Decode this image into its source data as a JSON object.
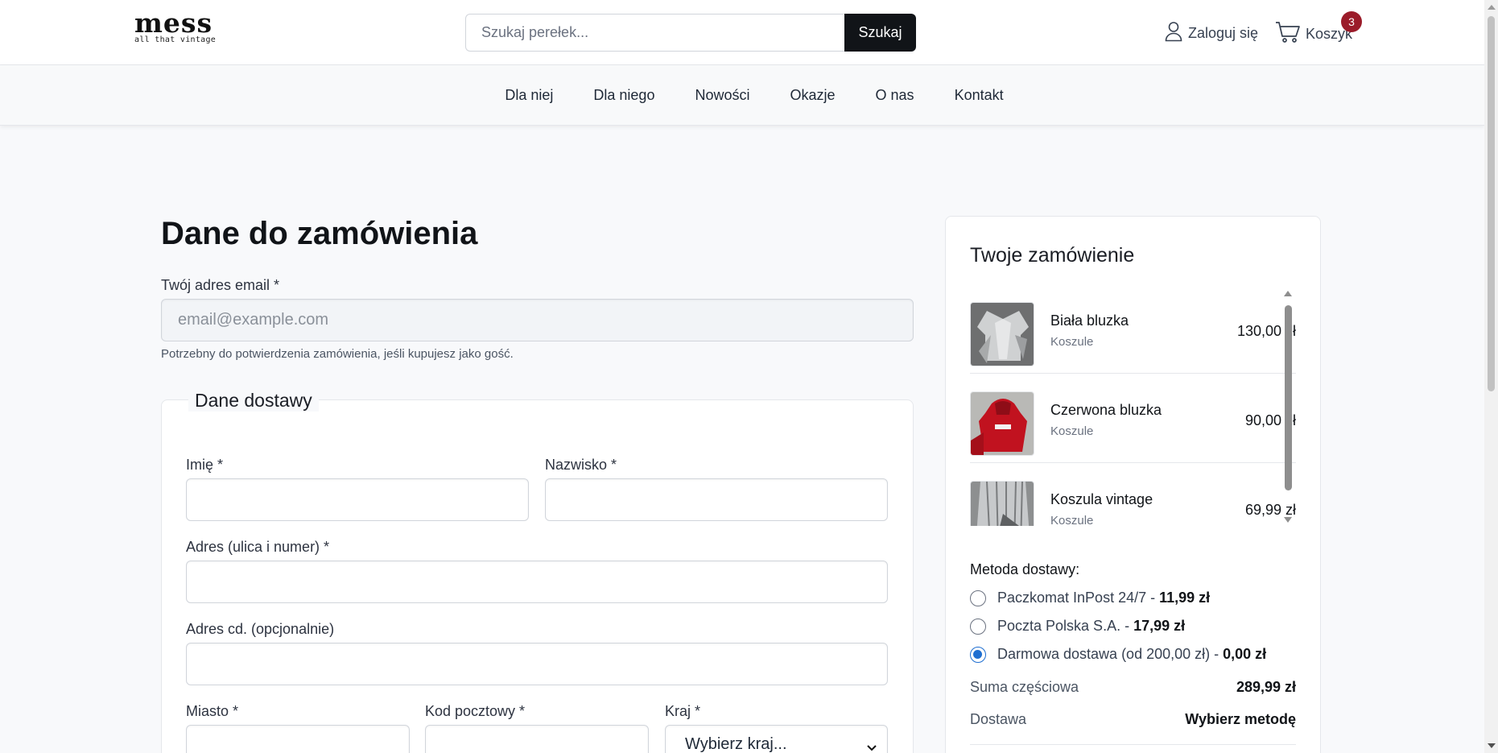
{
  "header": {
    "logo_main": "mess",
    "logo_sub": "all that vintage",
    "search_placeholder": "Szukaj perełek...",
    "search_button": "Szukaj",
    "login_label": "Zaloguj się",
    "cart_label": "Koszyk",
    "cart_count": "3"
  },
  "nav": {
    "items": [
      "Dla niej",
      "Dla niego",
      "Nowości",
      "Okazje",
      "O nas",
      "Kontakt"
    ]
  },
  "form": {
    "title": "Dane do zamówienia",
    "email_label": "Twój adres email *",
    "email_placeholder": "email@example.com",
    "email_help": "Potrzebny do potwierdzenia zamówienia, jeśli kupujesz jako gość.",
    "shipping_legend": "Dane dostawy",
    "first_name_label": "Imię *",
    "last_name_label": "Nazwisko *",
    "address_label": "Adres (ulica i numer) *",
    "address2_label": "Adres cd. (opcjonalnie)",
    "city_label": "Miasto *",
    "postal_label": "Kod pocztowy *",
    "country_label": "Kraj *",
    "country_value": "Wybierz kraj..."
  },
  "summary": {
    "title": "Twoje zamówienie",
    "items": [
      {
        "name": "Biała bluzka",
        "category": "Koszule",
        "price": "130,00 zł"
      },
      {
        "name": "Czerwona bluzka",
        "category": "Koszule",
        "price": "90,00 zł"
      },
      {
        "name": "Koszula vintage",
        "category": "Koszule",
        "price": "69,99 zł"
      }
    ],
    "shipping_title": "Metoda dostawy:",
    "shipping_options": [
      {
        "label": "Paczkomat InPost 24/7 - ",
        "price": "11,99 zł",
        "selected": false
      },
      {
        "label": "Poczta Polska S.A. - ",
        "price": "17,99 zł",
        "selected": false
      },
      {
        "label": "Darmowa dostawa (od 200,00 zł) - ",
        "price": "0,00 zł",
        "selected": true
      }
    ],
    "subtotal_label": "Suma częściowa",
    "subtotal_value": "289,99 zł",
    "delivery_label": "Dostawa",
    "delivery_value": "Wybierz metodę"
  },
  "colors": {
    "accent": "#111418",
    "badge": "#9b1c2a",
    "radio_selected": "#1f6fd1"
  }
}
